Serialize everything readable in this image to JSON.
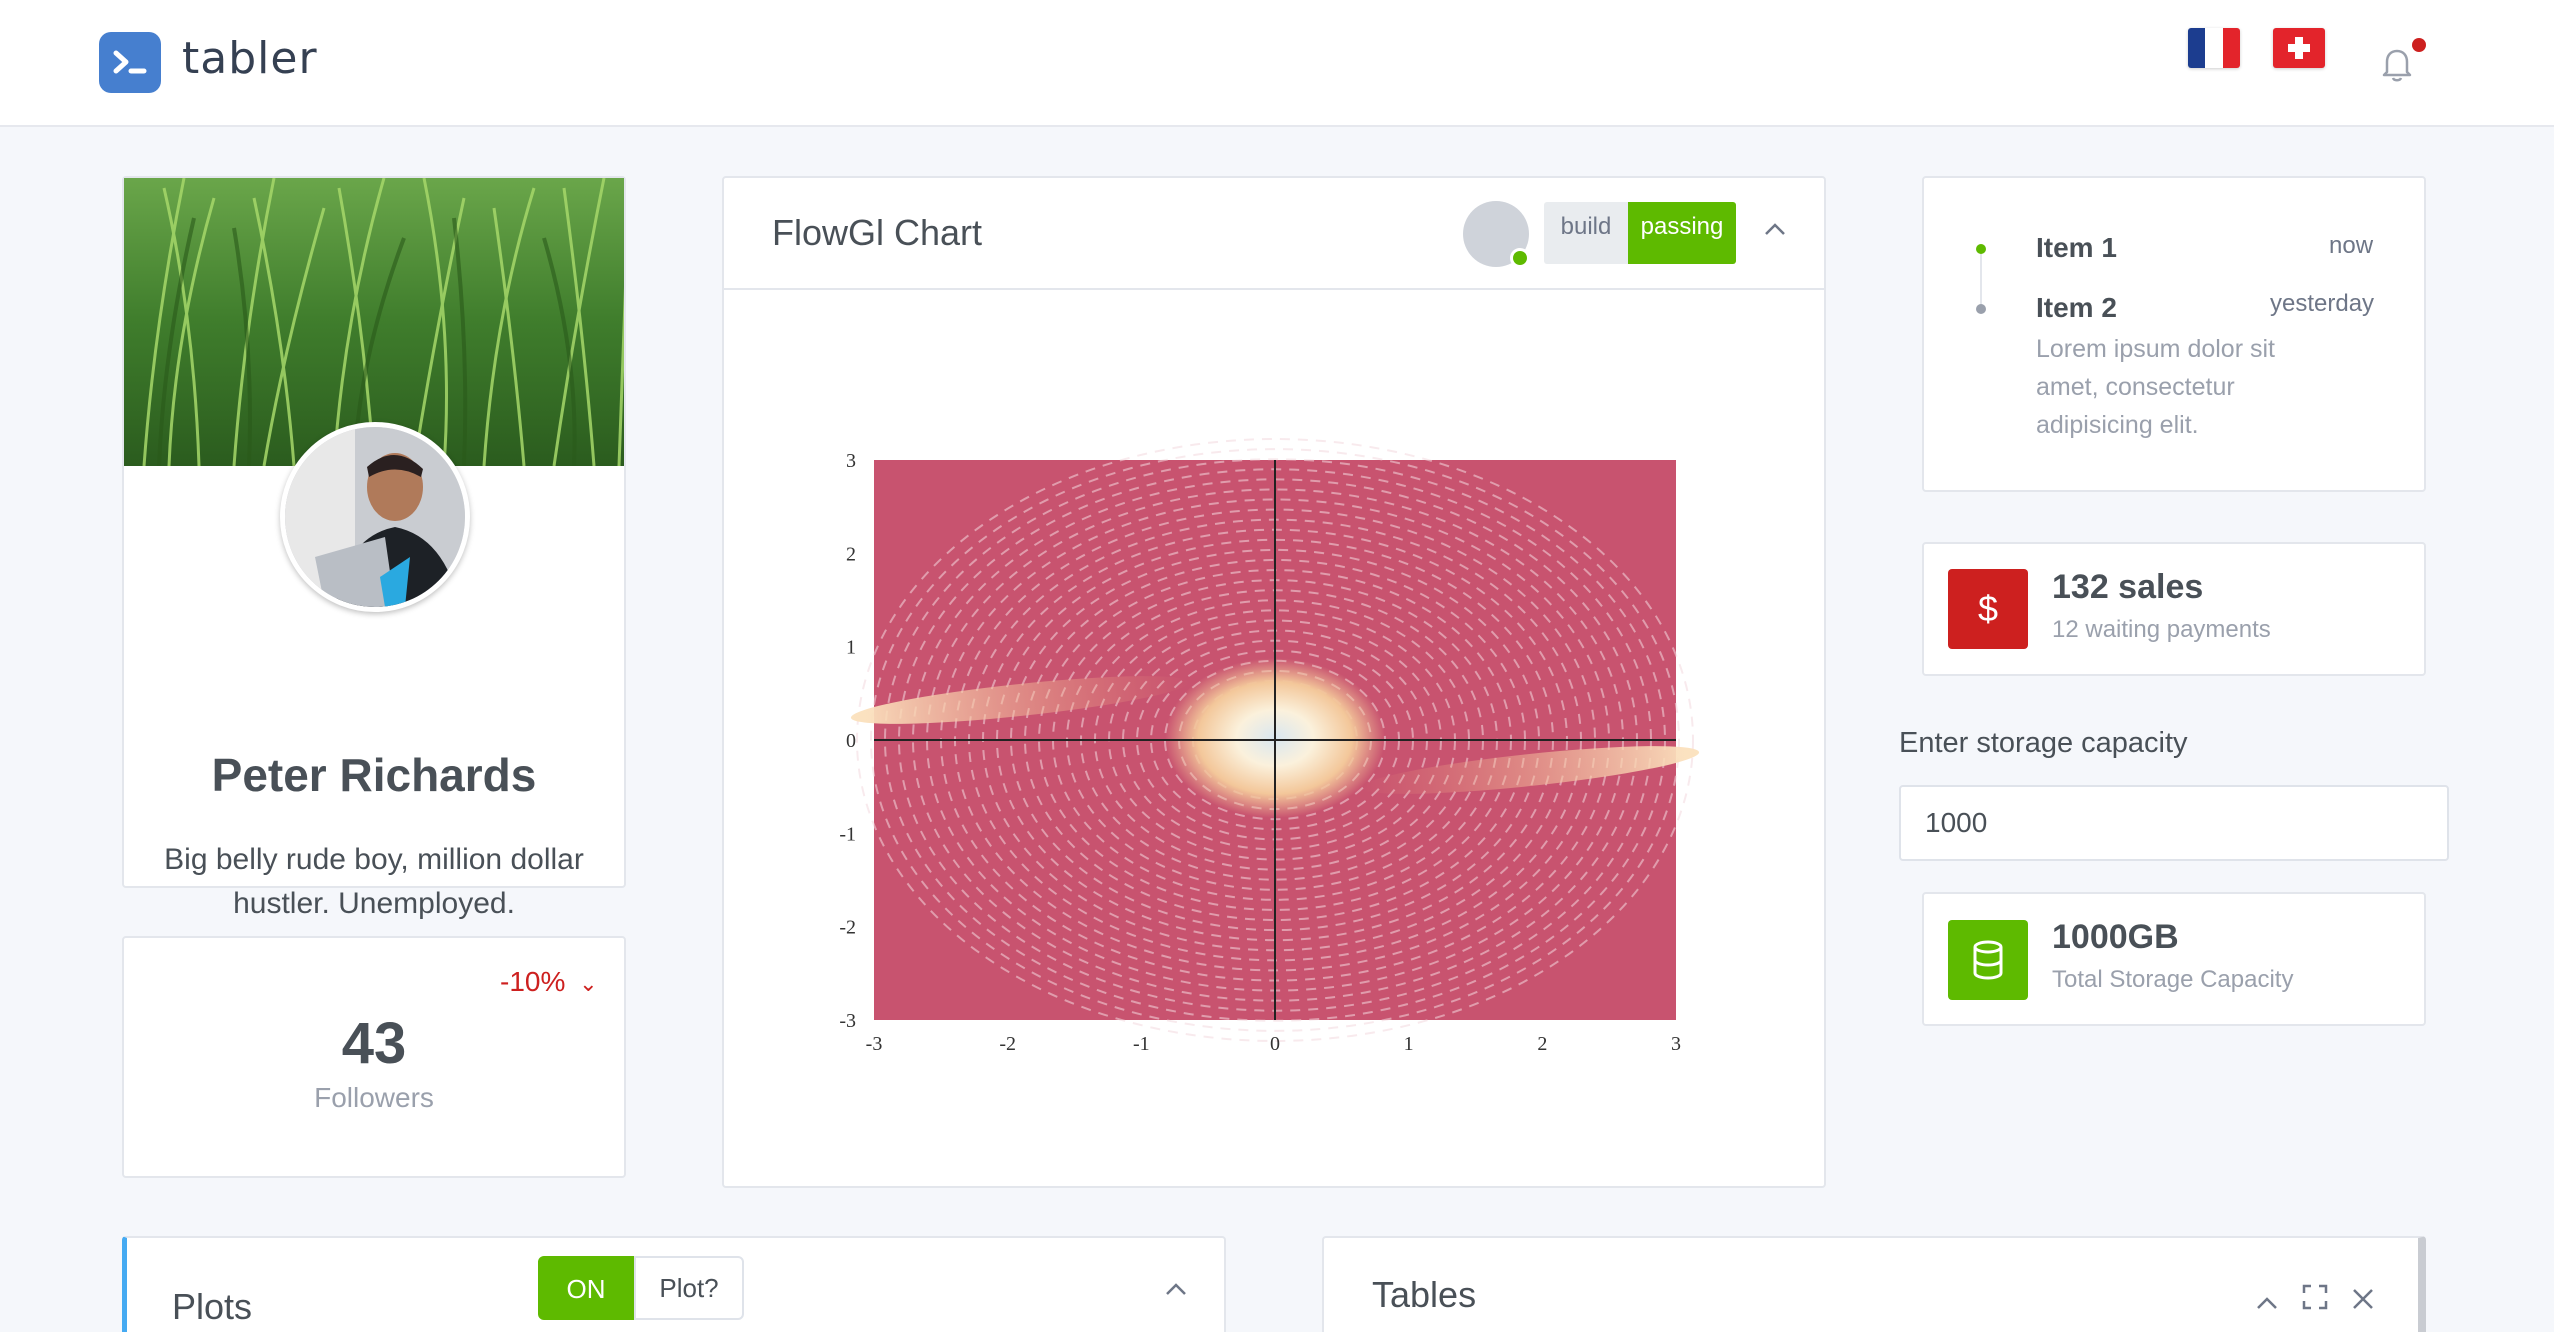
{
  "header": {
    "logo_text": "tabler",
    "notification_dot_color": "#cd201f",
    "icons": [
      "logo-terminal-icon",
      "flag-fr-icon",
      "flag-ch-icon",
      "bell-icon"
    ]
  },
  "profile": {
    "name": "Peter Richards",
    "bio": "Big belly rude boy, million dollar hustler. Unemployed.",
    "social_icons": [
      "facebook-icon",
      "twitter-icon"
    ]
  },
  "followers": {
    "count": "43",
    "label": "Followers",
    "change": "-10%"
  },
  "flow_chart": {
    "title": "FlowGl Chart",
    "badge_build": "build",
    "badge_status": "passing",
    "accent_color": "#5eba00"
  },
  "chart_data": {
    "type": "vector-field",
    "x_ticks": [
      "-3",
      "-2",
      "-1",
      "0",
      "1",
      "2",
      "3"
    ],
    "y_ticks": [
      "3",
      "2",
      "1",
      "0",
      "-1",
      "-2",
      "-3"
    ],
    "xlim": [
      -3,
      3
    ],
    "ylim": [
      -3,
      3
    ],
    "field_color": "#b8325a",
    "highlight_color": "#f6d6a8"
  },
  "timeline": [
    {
      "title": "Item 1",
      "time": "now",
      "dot_color": "#5eba00"
    },
    {
      "title": "Item 2",
      "time": "yesterday",
      "dot_color": "#9aa0ac",
      "description": "Lorem ipsum dolor sit amet, consectetur adipisicing elit."
    }
  ],
  "sales": {
    "icon_symbol": "$",
    "value": "132 sales",
    "sub": "12 waiting payments",
    "color": "#cd201f"
  },
  "storage_form": {
    "label": "Enter storage capacity",
    "value": "1000"
  },
  "storage": {
    "value": "1000GB",
    "sub": "Total Storage Capacity",
    "color": "#5eba00"
  },
  "plots": {
    "title": "Plots",
    "toggle_on": "ON",
    "toggle_label": "Plot?"
  },
  "tables": {
    "title": "Tables"
  }
}
